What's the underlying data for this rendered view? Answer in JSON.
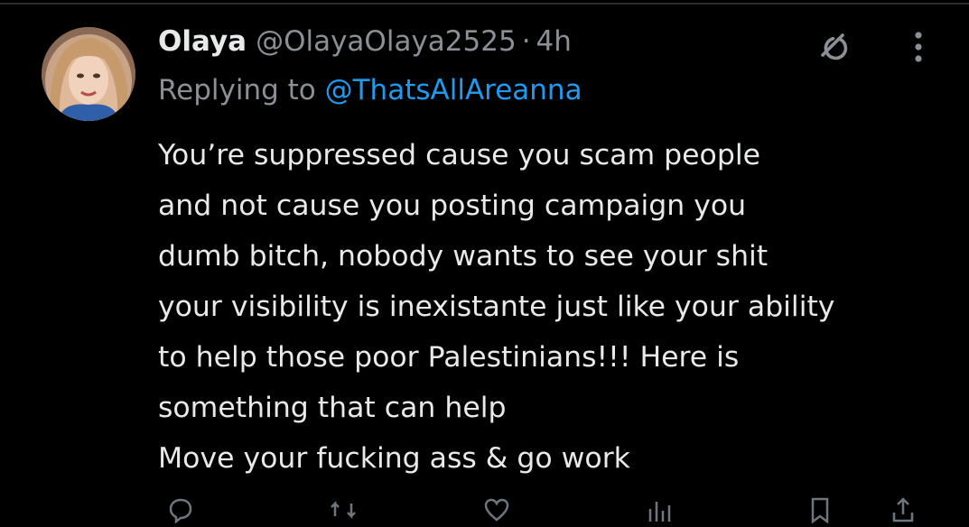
{
  "tweet": {
    "author_name": "Olaya",
    "author_handle": "@OlayaOlaya2525",
    "separator": "·",
    "time": "4h",
    "replying_prefix": "Replying to ",
    "replying_to": "@ThatsAllAreanna",
    "text_lines": [
      "You’re suppressed cause you scam people",
      "and not cause you posting campaign you",
      "dumb bitch, nobody wants to see your shit",
      "your visibility is inexistante just like your ability",
      "to help those poor Palestinians!!! Here is",
      "something that can help",
      "Move your fucking ass & go work"
    ]
  },
  "icons": {
    "avatar": "profile-photo",
    "grok": "grok-icon",
    "more": "more-vertical-icon",
    "reply": "reply-icon",
    "retweet": "retweet-icon",
    "like": "heart-icon",
    "views": "views-icon",
    "bookmark": "bookmark-icon",
    "share": "share-icon"
  },
  "colors": {
    "background": "#000000",
    "text": "#e7e9ea",
    "secondary": "#8b9096",
    "link": "#1d9bf0",
    "divider": "#2a2d30"
  }
}
